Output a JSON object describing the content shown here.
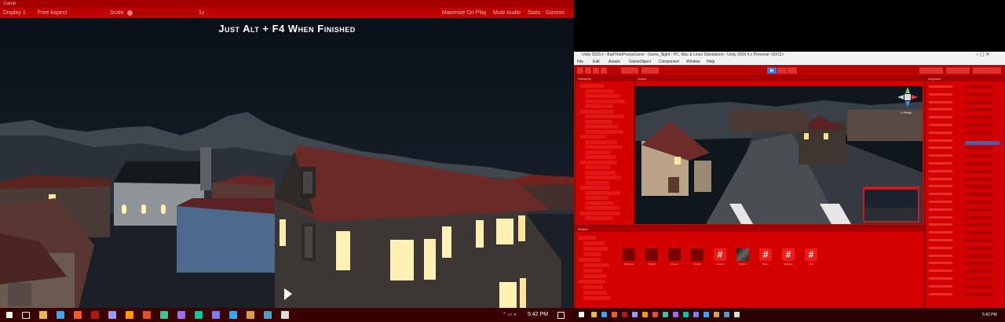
{
  "game_window": {
    "tab_label": "Game",
    "display": "Display 1",
    "aspect": "Free Aspect",
    "scale_label": "Scale",
    "scale_value": "1x",
    "maximize_label": "Maximize On Play",
    "mute_label": "Mute Audio",
    "stats_label": "Stats",
    "gizmos_label": "Gizmos",
    "overlay_text": "Just Alt + F4 When Finished"
  },
  "left_taskbar": {
    "clock": "5:42 PM",
    "apps": [
      {
        "name": "file-explorer",
        "color": "#e8b84a"
      },
      {
        "name": "edge",
        "color": "#3fa6e6"
      },
      {
        "name": "brave",
        "color": "#ff5a20"
      },
      {
        "name": "app-red",
        "color": "#b01818"
      },
      {
        "name": "after-effects",
        "color": "#9999ff"
      },
      {
        "name": "illustrator",
        "color": "#ff9a00"
      },
      {
        "name": "animate",
        "color": "#e34f2a"
      },
      {
        "name": "dreamweaver",
        "color": "#40c0a0"
      },
      {
        "name": "premiere",
        "color": "#9a6bff"
      },
      {
        "name": "audition",
        "color": "#00c8a0"
      },
      {
        "name": "character-animator",
        "color": "#7e7eff"
      },
      {
        "name": "photoshop",
        "color": "#31a8ff"
      },
      {
        "name": "bridge",
        "color": "#d8a040"
      },
      {
        "name": "gallery",
        "color": "#4aa0c0"
      },
      {
        "name": "unity",
        "color": "#dddddd"
      }
    ]
  },
  "editor": {
    "window_title": "Unity 2020.x - BadTimePeepsGame - Game_Night - PC, Mac & Linux Standalone - Unity 2019.4.x Personal <DX11>",
    "menu": [
      "File",
      "Edit",
      "Assets",
      "GameObject",
      "Component",
      "Window",
      "Help"
    ],
    "scene_gizmo_label": "< Persp",
    "project_assets": [
      {
        "kind": "folder",
        "label": "Materials"
      },
      {
        "kind": "folder",
        "label": "Prefabs"
      },
      {
        "kind": "folder",
        "label": "Scenes"
      },
      {
        "kind": "folder",
        "label": "Scripts"
      },
      {
        "kind": "script",
        "label": "Camera"
      },
      {
        "kind": "image",
        "label": "Skybox"
      },
      {
        "kind": "script",
        "label": "Player"
      },
      {
        "kind": "script",
        "label": "Manager"
      },
      {
        "kind": "script",
        "label": "Quit"
      }
    ],
    "hierarchy_rows": 27,
    "inspector_rows": 28
  },
  "right_taskbar": {
    "clock": "5:42 PM"
  },
  "theme": {
    "playmode_tint": "#cc0000",
    "toolbar": "#c00000",
    "taskbar": "#3a0000"
  }
}
